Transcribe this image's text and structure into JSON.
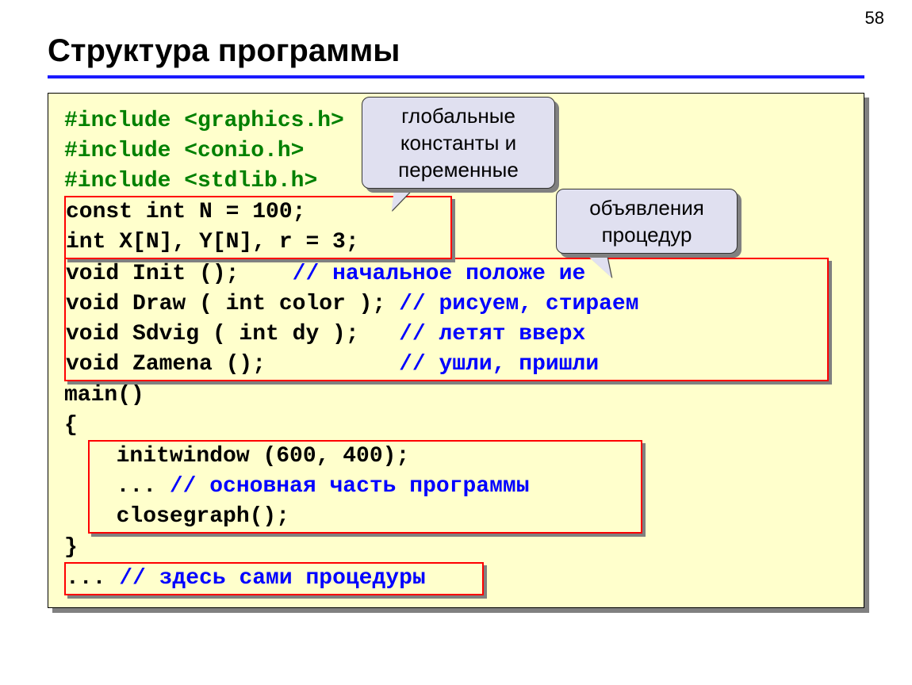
{
  "page_number": "58",
  "title": "Структура программы",
  "code": {
    "inc1": "#include <graphics.h>",
    "inc2": "#include <conio.h>",
    "inc3": "#include <stdlib.h>",
    "globals_l1": "const int N = 100;",
    "globals_l2": "int X[N], Y[N], r = 3;",
    "p1a": "void Init ();    ",
    "p1b": "// начальное положе ие",
    "p2a": "void Draw ( int color ); ",
    "p2b": "// рисуем, стираем",
    "p3a": "void Sdvig ( int dy );   ",
    "p3b": "// летят вверх",
    "p4a": "void Zamena ();          ",
    "p4b": "// ушли, пришли",
    "main_l1": "main()",
    "main_l2": "{",
    "body_l1": "  initwindow (600, 400);",
    "body_l2a": "  ... ",
    "body_l2b": "// основная часть программы",
    "body_l3": "  closegraph();",
    "main_l4": "}",
    "foot_a": "... ",
    "foot_b": "// здесь сами процедуры"
  },
  "callouts": {
    "c1": "глобальные константы и переменные",
    "c2": "объявления процедур"
  }
}
